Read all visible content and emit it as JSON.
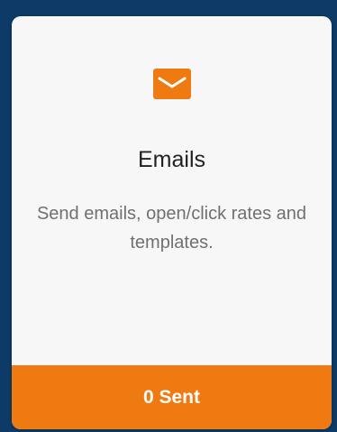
{
  "card": {
    "title": "Emails",
    "description": "Send emails, open/click rates and templates.",
    "icon": "envelope-icon",
    "footer_label": "0 Sent"
  },
  "colors": {
    "background": "#0d3a66",
    "card": "#f7f7f7",
    "accent": "#f07a12",
    "title": "#222222",
    "description": "#707070"
  }
}
